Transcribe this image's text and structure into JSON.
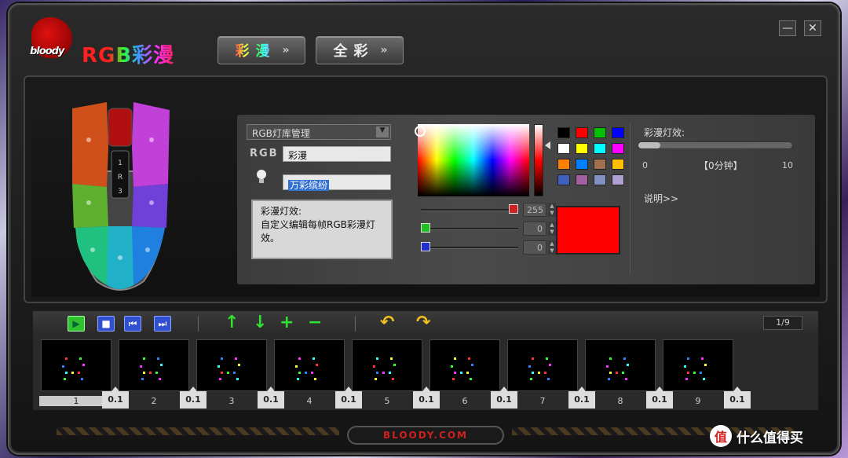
{
  "app": {
    "logo_text": "bloody",
    "title": "RGB彩漫",
    "minimize_label": "—",
    "close_label": "✕"
  },
  "tabs": [
    {
      "label": "彩漫",
      "chevron": "»"
    },
    {
      "label": "全彩",
      "chevron": "»"
    }
  ],
  "editor": {
    "library_select": "RGB灯库管理",
    "rgb_label": "RGB",
    "name_value": "彩漫",
    "effect_value": "万彩缤纷",
    "description": "彩漫灯效:\n自定义编辑每帧RGB彩漫灯效。",
    "icons": {
      "bulb": "lightbulb-icon",
      "dropdown": "triangle-down-icon"
    }
  },
  "color": {
    "swatches": [
      "#000000",
      "#ff0000",
      "#00c000",
      "#0000ff",
      "#ffffff",
      "#ffff00",
      "#00ffff",
      "#ff00ff",
      "#ff8000",
      "#0080ff",
      "#a07050",
      "#ffc000",
      "#4060c0",
      "#a060a0",
      "#8090c0",
      "#b0a0d0"
    ],
    "r_value": "255",
    "g_value": "0",
    "b_value": "0",
    "preview_color": "#ff0000",
    "r_level": 1,
    "g_level": 0,
    "b_level": 0
  },
  "speed": {
    "title": "彩漫灯效:",
    "min_label": "0",
    "current_label": "【0分钟】",
    "max_label": "10",
    "level": 0,
    "explain_link": "说明>>"
  },
  "toolbar": {
    "icons": [
      "play-icon",
      "stop-icon",
      "first-frame-icon",
      "last-frame-icon",
      "arrow-up-icon",
      "arrow-down-icon",
      "plus-icon",
      "minus-icon",
      "undo-icon",
      "redo-icon"
    ],
    "page_count": "1/9"
  },
  "frames": [
    {
      "number": "1",
      "duration": "0.1"
    },
    {
      "number": "2",
      "duration": "0.1"
    },
    {
      "number": "3",
      "duration": "0.1"
    },
    {
      "number": "4",
      "duration": "0.1"
    },
    {
      "number": "5",
      "duration": "0.1"
    },
    {
      "number": "6",
      "duration": "0.1"
    },
    {
      "number": "7",
      "duration": "0.1"
    },
    {
      "number": "8",
      "duration": "0.1"
    },
    {
      "number": "9",
      "duration": "0.1"
    }
  ],
  "footer": {
    "brand": "BLOODY.COM"
  },
  "watermark": {
    "badge": "值",
    "text": "什么值得买"
  }
}
